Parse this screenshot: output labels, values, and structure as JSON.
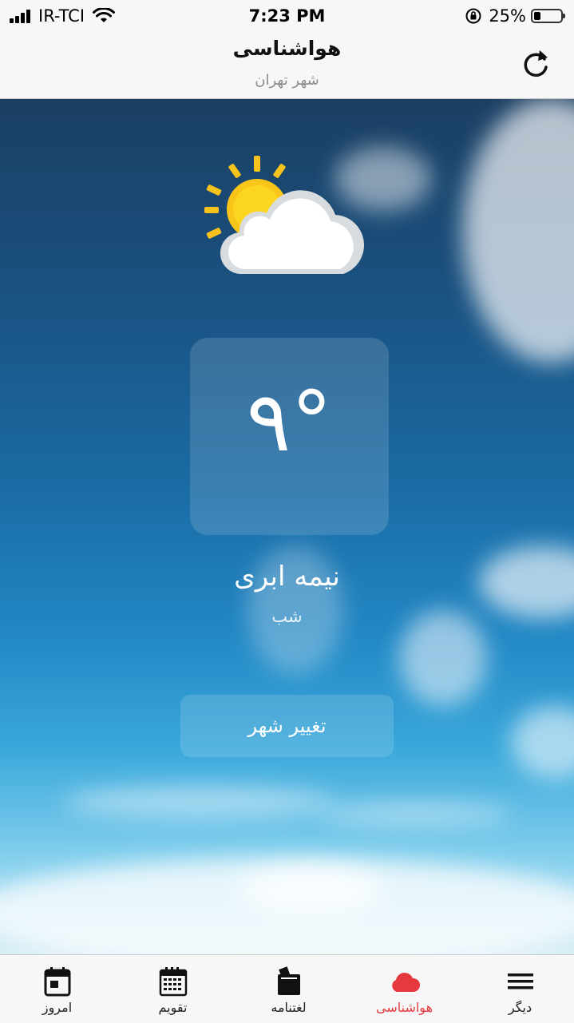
{
  "status_bar": {
    "carrier": "IR-TCI",
    "time": "7:23 PM",
    "battery": "25%",
    "battery_level": 0.25
  },
  "header": {
    "title": "هواشناسی",
    "subtitle": "شهر تهران",
    "refresh_icon": "refresh-icon"
  },
  "weather": {
    "icon": "partly-cloudy-icon",
    "temperature": "۹°",
    "condition": "نیمه ابری",
    "period": "شب"
  },
  "actions": {
    "change_city": "تغییر شهر"
  },
  "tabs": [
    {
      "label": "امروز",
      "icon": "today-calendar-icon",
      "active": false
    },
    {
      "label": "تقویم",
      "icon": "calendar-icon",
      "active": false
    },
    {
      "label": "لغتنامه",
      "icon": "dictionary-icon",
      "active": false
    },
    {
      "label": "هواشناسی",
      "icon": "weather-cloud-icon",
      "active": true
    },
    {
      "label": "دیگر",
      "icon": "menu-icon",
      "active": false
    }
  ],
  "colors": {
    "accent": "#e5393d"
  }
}
